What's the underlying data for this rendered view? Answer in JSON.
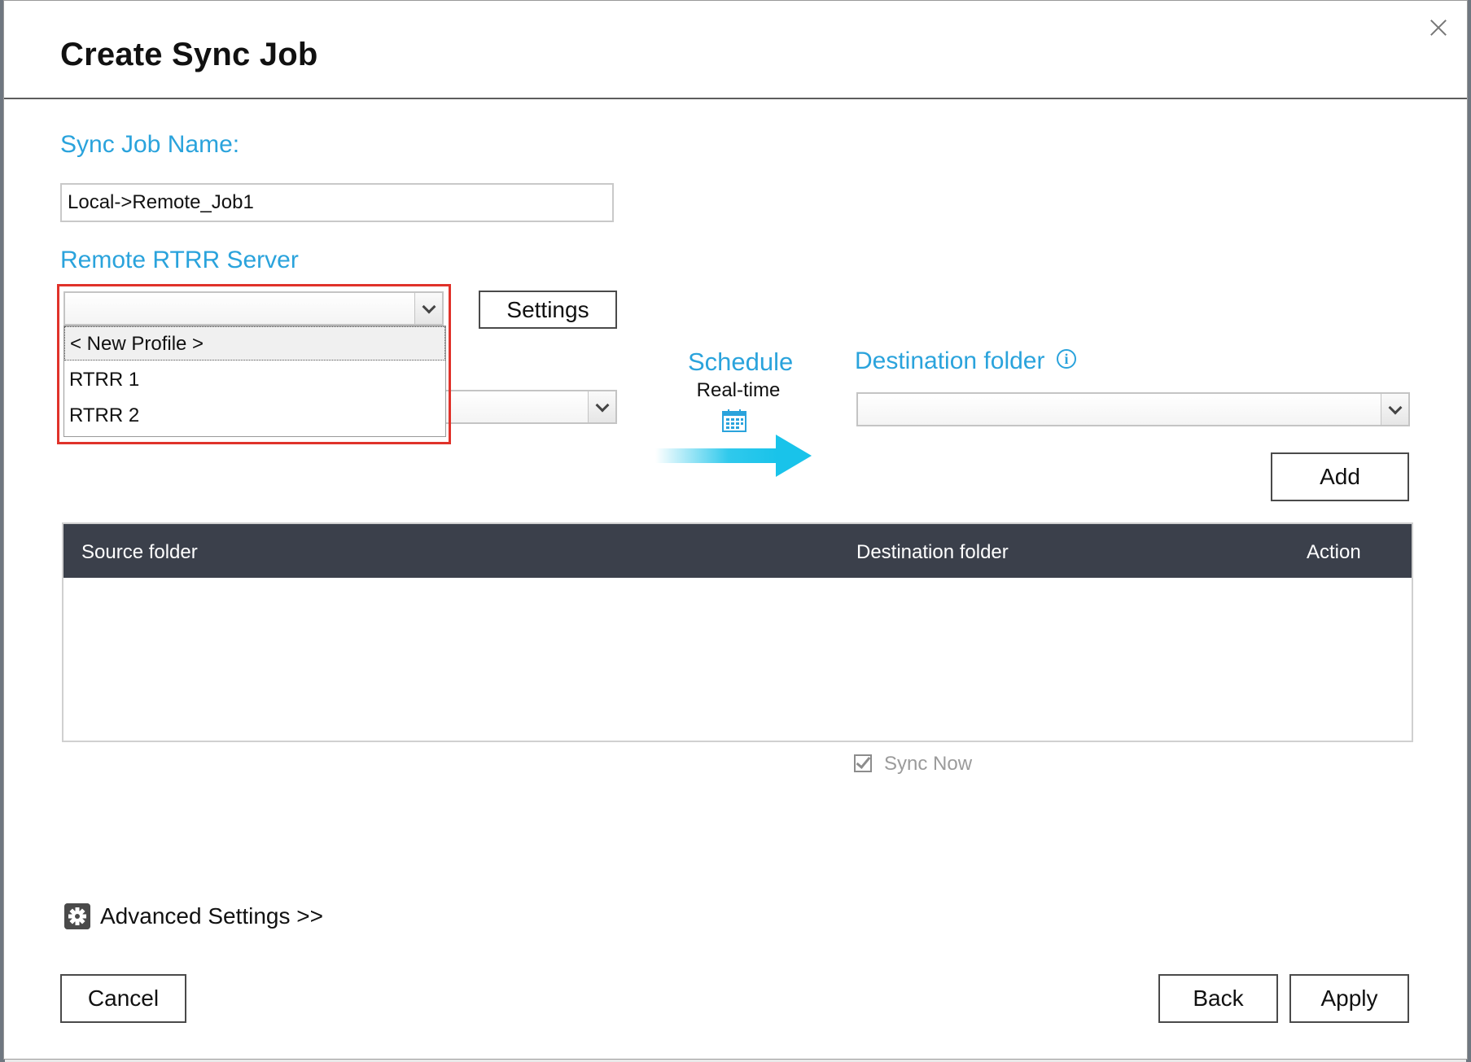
{
  "dialog": {
    "title": "Create Sync Job"
  },
  "form": {
    "job_name_label": "Sync Job Name:",
    "job_name_value": "Local->Remote_Job1",
    "server_label": "Remote RTRR Server",
    "server_selected": "",
    "settings_button": "Settings",
    "server_options": [
      "< New Profile >",
      "RTRR 1",
      "RTRR 2"
    ],
    "source_selected": ""
  },
  "schedule": {
    "label": "Schedule",
    "value": "Real-time"
  },
  "destination": {
    "label": "Destination folder",
    "selected": "",
    "add_button": "Add"
  },
  "table": {
    "columns": [
      "Source folder",
      "Destination folder",
      "Action"
    ],
    "rows": []
  },
  "sync_now": {
    "label": "Sync Now",
    "checked": true
  },
  "advanced": {
    "label": "Advanced Settings >>"
  },
  "footer": {
    "cancel": "Cancel",
    "back": "Back",
    "apply": "Apply"
  },
  "colors": {
    "accent": "#2aa3dc",
    "header_bg": "#3b404b",
    "highlight": "#e0322a",
    "arrow": "#19c3ea"
  },
  "icons": {
    "close": "close-icon",
    "dropdown": "chevron-down-icon",
    "calendar": "calendar-icon",
    "arrow": "arrow-right-icon",
    "info": "info-icon",
    "gear": "gear-icon",
    "checkbox": "checkbox-icon"
  }
}
